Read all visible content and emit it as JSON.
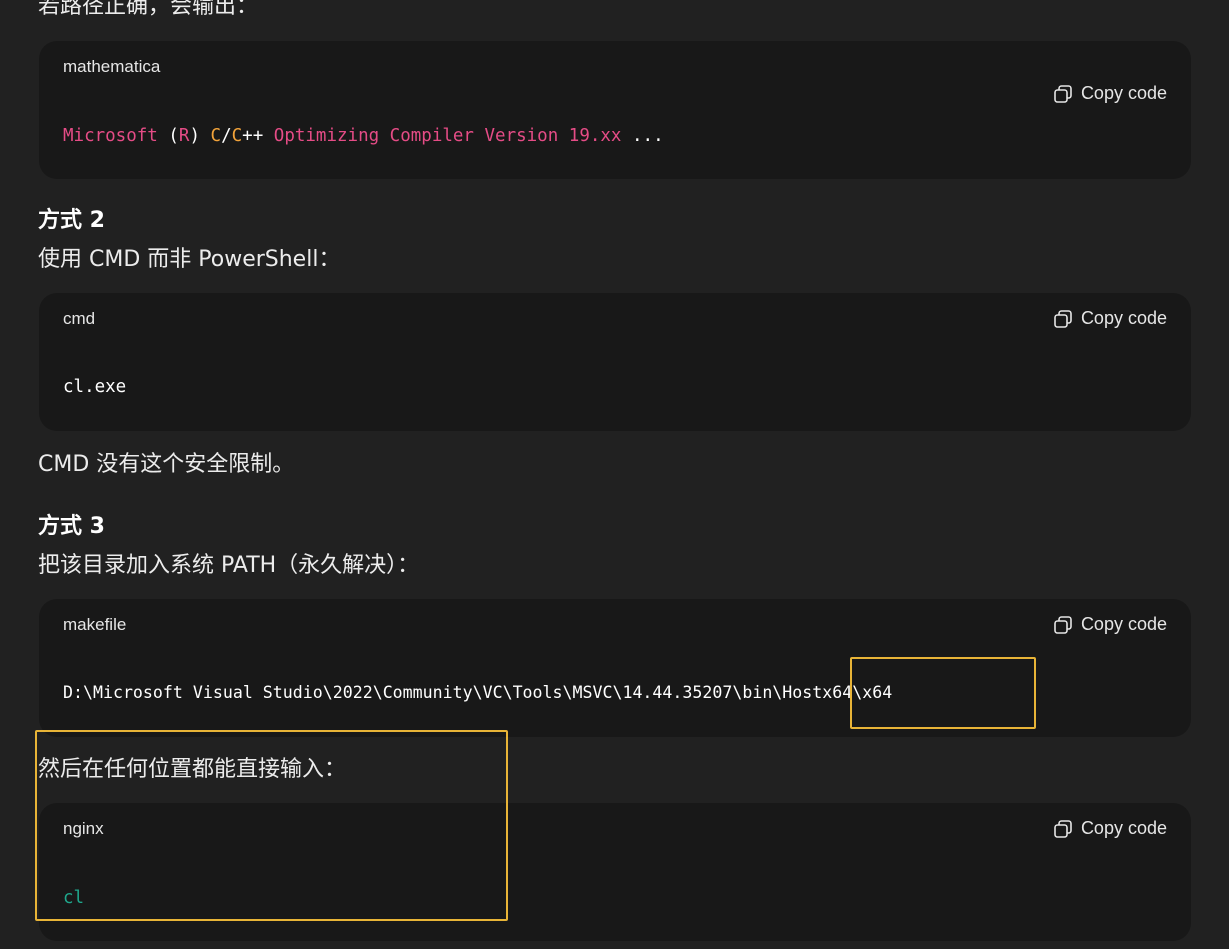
{
  "intro_text": "若路径正确，会输出：",
  "copy_label": "Copy code",
  "block1": {
    "lang": "mathematica",
    "tokens": [
      {
        "text": "Microsoft",
        "color": "magenta"
      },
      {
        "text": " (",
        "color": "white"
      },
      {
        "text": "R",
        "color": "magenta"
      },
      {
        "text": ") ",
        "color": "white"
      },
      {
        "text": "C",
        "color": "orange"
      },
      {
        "text": "/",
        "color": "white"
      },
      {
        "text": "C",
        "color": "orange"
      },
      {
        "text": "++ ",
        "color": "white"
      },
      {
        "text": "Optimizing Compiler Version 19.xx",
        "color": "magenta"
      },
      {
        "text": " ...",
        "color": "white"
      }
    ]
  },
  "method2": {
    "heading": "方式 2",
    "text": "使用 CMD 而非 PowerShell："
  },
  "block2": {
    "lang": "cmd",
    "code": "cl.exe"
  },
  "cmd_note": "CMD 没有这个安全限制。",
  "method3": {
    "heading": "方式 3",
    "text": "把该目录加入系统 PATH（永久解决）："
  },
  "block3": {
    "lang": "makefile",
    "code": "D:\\Microsoft Visual Studio\\2022\\Community\\VC\\Tools\\MSVC\\14.44.35207\\bin\\Hostx64\\x64"
  },
  "anywhere_text": "然后在任何位置都能直接输入：",
  "block4": {
    "lang": "nginx",
    "code": "cl"
  },
  "colors": {
    "background": "#212121",
    "code_background": "#181818",
    "highlight": "#e8b437",
    "magenta": "#e54c86",
    "orange": "#f2a33a",
    "green": "#1fa68b"
  }
}
